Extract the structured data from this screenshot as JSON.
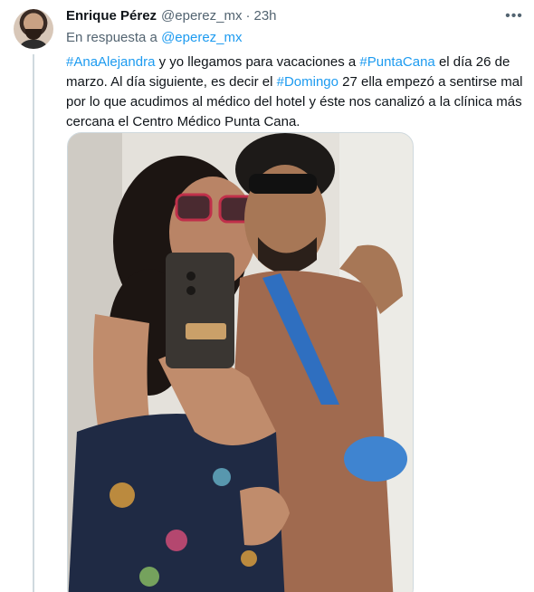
{
  "tweet": {
    "author_name": "Enrique Pérez",
    "author_handle": "@eperez_mx",
    "separator": "·",
    "time": "23h",
    "reply_prefix": "En respuesta a",
    "reply_mention": "@eperez_mx",
    "text_parts": [
      {
        "type": "hashtag",
        "text": "#AnaAlejandra"
      },
      {
        "type": "text",
        "text": " y yo llegamos para vacaciones a "
      },
      {
        "type": "hashtag",
        "text": "#PuntaCana"
      },
      {
        "type": "text",
        "text": " el día 26 de marzo. Al día siguiente, es decir el "
      },
      {
        "type": "hashtag",
        "text": "#Domingo"
      },
      {
        "type": "text",
        "text": " 27 ella empezó a sentirse mal por lo que acudimos al médico del hotel y éste nos canalizó a la clínica más cercana el Centro Médico Punta Cana."
      }
    ],
    "more_icon": "more-horizontal-icon"
  },
  "colors": {
    "link": "#1d9bf0",
    "secondary_text": "#536471",
    "primary_text": "#0f1419",
    "border": "#cfd9de"
  }
}
